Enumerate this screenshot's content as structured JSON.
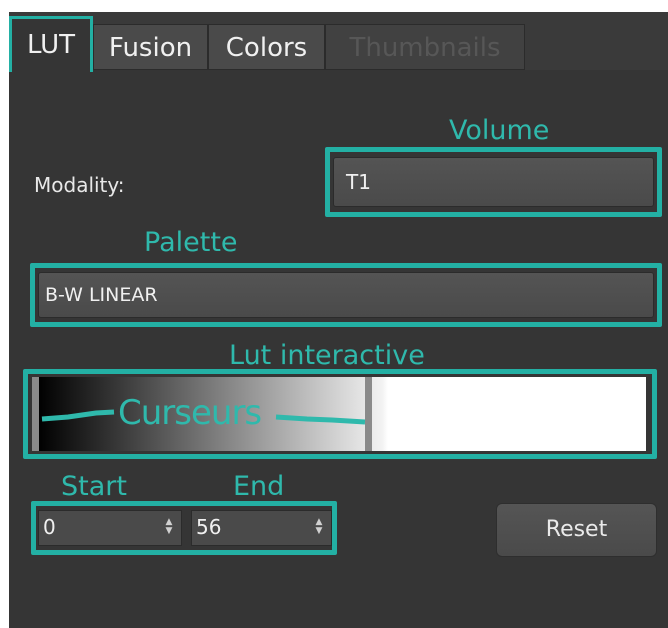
{
  "tabs": [
    {
      "label": "LUT",
      "state": "active"
    },
    {
      "label": "Fusion",
      "state": "normal"
    },
    {
      "label": "Colors",
      "state": "normal"
    },
    {
      "label": "Thumbnails",
      "state": "disabled"
    }
  ],
  "annotations": {
    "volume": "Volume",
    "palette": "Palette",
    "lut_interactive": "Lut interactive",
    "cursors": "Curseurs",
    "start": "Start",
    "end": "End"
  },
  "modality": {
    "label": "Modality:",
    "value": "T1"
  },
  "palette": {
    "value": "B-W LINEAR"
  },
  "lut": {
    "start_value": "0",
    "end_value": "56"
  },
  "reset_label": "Reset",
  "colors": {
    "highlight": "#23b0a4",
    "panel_bg": "#353535",
    "field_bg": "#4a4a4a"
  }
}
